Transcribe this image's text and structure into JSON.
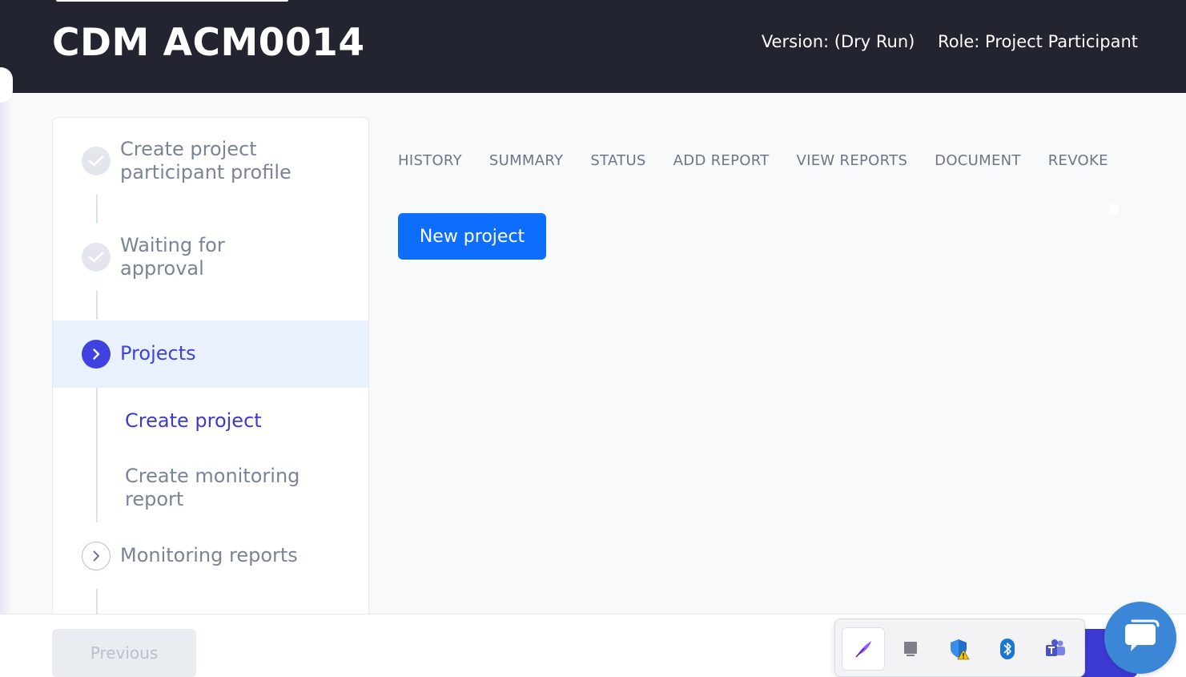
{
  "header": {
    "title": "CDM ACM0014",
    "version": "Version: (Dry Run)",
    "role": "Role: Project Participant"
  },
  "steps": [
    {
      "label_line1": "Create project",
      "label_line2": "participant profile",
      "status": "done"
    },
    {
      "label_line1": "Waiting for",
      "label_line2": "approval",
      "status": "done"
    },
    {
      "label": "Projects",
      "status": "active"
    },
    {
      "label": "Monitoring reports",
      "status": "pending"
    }
  ],
  "substeps": [
    {
      "label": "Create project",
      "current": true
    },
    {
      "label_line1": "Create monitoring",
      "label_line2": "report",
      "current": false
    }
  ],
  "tabs": [
    "HISTORY",
    "SUMMARY",
    "STATUS",
    "ADD REPORT",
    "VIEW REPORTS",
    "DOCUMENT",
    "REVOKE"
  ],
  "main": {
    "new_project_label": "New project"
  },
  "footer": {
    "previous_label": "Previous"
  },
  "tray": {
    "icons": [
      "feather-pen-icon",
      "display-icon",
      "security-shield-warning-icon",
      "bluetooth-icon",
      "teams-icon"
    ]
  },
  "colors": {
    "header_bg": "#22252f",
    "accent": "#4141e0",
    "primary_button": "#0d6efd",
    "chat_bubble": "#3b86d6"
  }
}
